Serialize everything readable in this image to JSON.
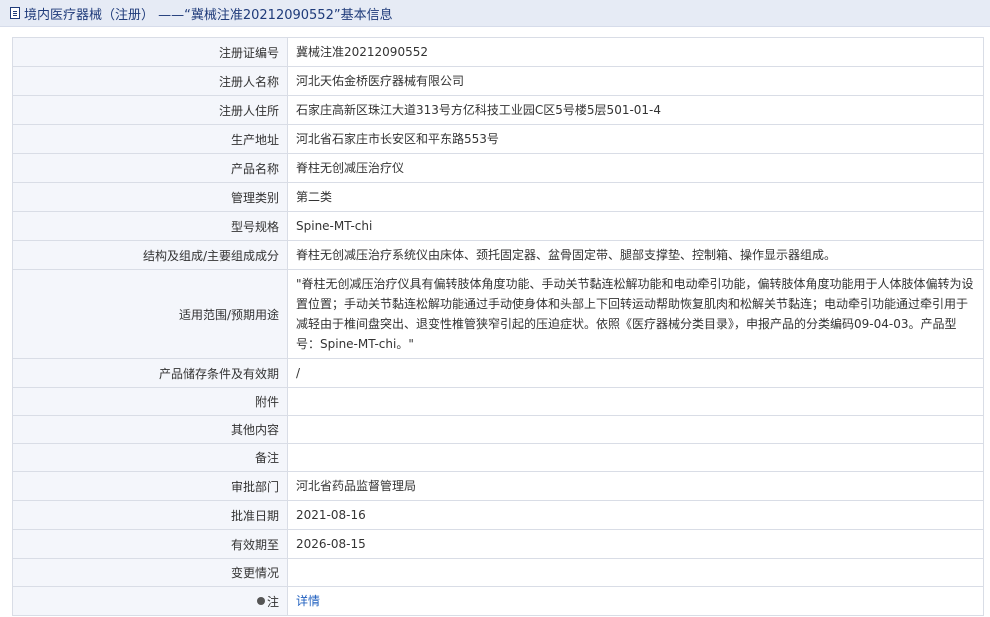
{
  "header": {
    "title": "境内医疗器械（注册） ——“冀械注准20212090552”基本信息"
  },
  "rows": [
    {
      "label": "注册证编号",
      "value": "冀械注准20212090552"
    },
    {
      "label": "注册人名称",
      "value": "河北天佑金桥医疗器械有限公司"
    },
    {
      "label": "注册人住所",
      "value": "石家庄高新区珠江大道313号方亿科技工业园C区5号楼5层501-01-4"
    },
    {
      "label": "生产地址",
      "value": "河北省石家庄市长安区和平东路553号"
    },
    {
      "label": "产品名称",
      "value": "脊柱无创减压治疗仪"
    },
    {
      "label": "管理类别",
      "value": "第二类"
    },
    {
      "label": "型号规格",
      "value": "Spine-MT-chi"
    },
    {
      "label": "结构及组成/主要组成成分",
      "value": "脊柱无创减压治疗系统仪由床体、颈托固定器、盆骨固定带、腿部支撑垫、控制箱、操作显示器组成。"
    },
    {
      "label": "适用范围/预期用途",
      "value": "\"脊柱无创减压治疗仪具有偏转肢体角度功能、手动关节黏连松解功能和电动牵引功能，偏转肢体角度功能用于人体肢体偏转为设置位置；手动关节黏连松解功能通过手动使身体和头部上下回转运动帮助恢复肌肉和松解关节黏连；电动牵引功能通过牵引用于减轻由于椎间盘突出、退变性椎管狭窄引起的压迫症状。依照《医疗器械分类目录》，申报产品的分类编码09-04-03。产品型号：Spine-MT-chi。\""
    },
    {
      "label": "产品储存条件及有效期",
      "value": "/"
    },
    {
      "label": "附件",
      "value": ""
    },
    {
      "label": "其他内容",
      "value": ""
    },
    {
      "label": "备注",
      "value": ""
    },
    {
      "label": "审批部门",
      "value": "河北省药品监督管理局"
    },
    {
      "label": "批准日期",
      "value": "2021-08-16"
    },
    {
      "label": "有效期至",
      "value": "2026-08-15"
    },
    {
      "label": "变更情况",
      "value": ""
    }
  ],
  "note": {
    "label": "注",
    "link": "详情"
  }
}
